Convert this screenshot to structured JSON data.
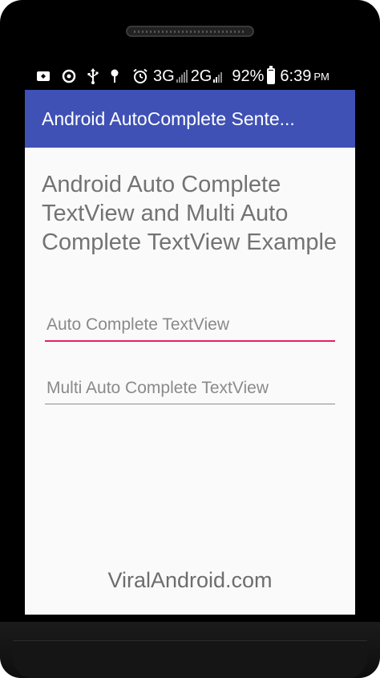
{
  "status_bar": {
    "icons": [
      "notification-icon",
      "sync-icon",
      "usb-icon",
      "location-icon",
      "alarm-icon"
    ],
    "network_1": "3G",
    "network_2": "2G",
    "battery_percent": "92%",
    "battery_level": 0.92,
    "time": "6:39",
    "ampm": "PM"
  },
  "app_bar": {
    "title": "Android AutoComplete Sente...",
    "color": "#3f51b5"
  },
  "main": {
    "heading": "Android Auto Complete TextView and Multi Auto Complete TextView Example",
    "auto_complete": {
      "placeholder": "Auto Complete TextView",
      "value": "",
      "focused": true,
      "accent_color": "#e91e63"
    },
    "multi_auto_complete": {
      "placeholder": "Multi Auto Complete TextView",
      "value": ""
    }
  },
  "footer": {
    "text": "ViralAndroid.com"
  }
}
